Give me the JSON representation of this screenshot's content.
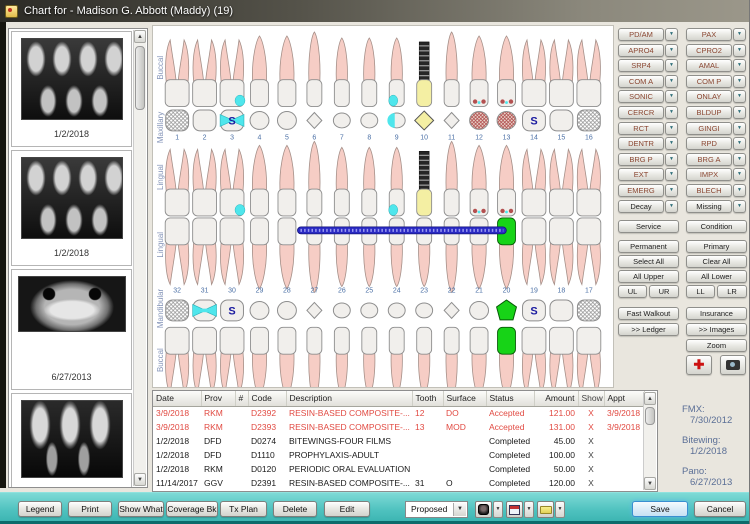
{
  "window": {
    "title": "Chart for - Madison G. Abbott (Maddy) (19)"
  },
  "sidebar": {
    "thumbnails": [
      {
        "date": "1/2/2018",
        "kind": "bitewing"
      },
      {
        "date": "1/2/2018",
        "kind": "bitewing"
      },
      {
        "date": "6/27/2013",
        "kind": "pano"
      },
      {
        "date": "",
        "kind": "periapical"
      }
    ]
  },
  "chart": {
    "region_labels": {
      "maxillary": "Maxillary",
      "mandibular": "Mandibular",
      "buccal": "Buccal",
      "lingual": "Lingual"
    },
    "upper_teeth": [
      {
        "n": 1,
        "type": "molar",
        "occ": "hatch"
      },
      {
        "n": 2,
        "type": "molar"
      },
      {
        "n": 3,
        "type": "molar",
        "occ": "bowtie+S",
        "crown": "cyan-distal"
      },
      {
        "n": 4,
        "type": "premolar"
      },
      {
        "n": 5,
        "type": "premolar"
      },
      {
        "n": 6,
        "type": "canine"
      },
      {
        "n": 7,
        "type": "incisor"
      },
      {
        "n": 8,
        "type": "incisor"
      },
      {
        "n": 9,
        "type": "incisor",
        "occ": "cyan",
        "crown": "cyan-corner"
      },
      {
        "n": 10,
        "type": "incisor",
        "occ": "yellow",
        "crown": "implant"
      },
      {
        "n": 11,
        "type": "canine"
      },
      {
        "n": 12,
        "type": "premolar",
        "occ": "red",
        "crown": "red-spots"
      },
      {
        "n": 13,
        "type": "premolar",
        "occ": "red",
        "crown": "red-spots"
      },
      {
        "n": 14,
        "type": "molar",
        "occ": "S"
      },
      {
        "n": 15,
        "type": "molar"
      },
      {
        "n": 16,
        "type": "molar",
        "occ": "hatch"
      }
    ],
    "lower_teeth": [
      {
        "n": 32,
        "type": "molar",
        "occ": "hatch"
      },
      {
        "n": 31,
        "type": "molar",
        "occ": "bowtie"
      },
      {
        "n": 30,
        "type": "molar",
        "occ": "S"
      },
      {
        "n": 29,
        "type": "premolar"
      },
      {
        "n": 28,
        "type": "premolar"
      },
      {
        "n": 27,
        "type": "canine"
      },
      {
        "n": 26,
        "type": "incisor"
      },
      {
        "n": 25,
        "type": "incisor"
      },
      {
        "n": 24,
        "type": "incisor"
      },
      {
        "n": 23,
        "type": "incisor"
      },
      {
        "n": 22,
        "type": "canine"
      },
      {
        "n": 21,
        "type": "premolar"
      },
      {
        "n": 20,
        "type": "premolar",
        "occ": "green",
        "crown": "green"
      },
      {
        "n": 19,
        "type": "molar",
        "occ": "S"
      },
      {
        "n": 18,
        "type": "molar"
      },
      {
        "n": 17,
        "type": "molar",
        "occ": "hatch"
      }
    ],
    "retainer_span": {
      "from": "27",
      "to": "21"
    }
  },
  "procedure_buttons": {
    "col1": [
      "PD/AM",
      "APRO4",
      "SRP4",
      "COM A",
      "SONIC",
      "CERCR",
      "RCT",
      "DENTR",
      "BRG P",
      "EXT",
      "EMERG"
    ],
    "col2": [
      "PAX",
      "CPRO2",
      "AMAL",
      "COM P",
      "ONLAY",
      "BLDUP",
      "GINGI",
      "RPD",
      "BRG A",
      "IMPX",
      "BLECH"
    ],
    "decay": "Decay",
    "missing": "Missing"
  },
  "selection_buttons": {
    "service": "Service",
    "condition": "Condition",
    "permanent": "Permanent",
    "primary": "Primary",
    "select_all": "Select All",
    "clear_all": "Clear All",
    "all_upper": "All Upper",
    "all_lower": "All Lower",
    "ul": "UL",
    "ur": "UR",
    "ll": "LL",
    "lr": "LR"
  },
  "nav_buttons": {
    "fast_walkout": "Fast Walkout",
    "insurance": "Insurance",
    "ledger": ">> Ledger",
    "images": ">> Images",
    "zoom": "Zoom"
  },
  "xray_summary": [
    {
      "label": "FMX:",
      "date": "7/30/2012"
    },
    {
      "label": "Bitewing:",
      "date": "1/2/2018"
    },
    {
      "label": "Pano:",
      "date": "6/27/2013"
    }
  ],
  "procedure_table": {
    "columns": [
      "Date",
      "Prov",
      "#",
      "Code",
      "Description",
      "Tooth",
      "Surface",
      "Status",
      "Amount",
      "Show",
      "Appt"
    ],
    "rows": [
      {
        "date": "3/9/2018",
        "prov": "RKM",
        "num": "",
        "code": "D2392",
        "description": "RESIN-BASED COMPOSITE-...",
        "tooth": "12",
        "surface": "DO",
        "status": "Accepted",
        "amount": "121.00",
        "show": "X",
        "appt": "3/9/2018",
        "highlight": "red"
      },
      {
        "date": "3/9/2018",
        "prov": "RKM",
        "num": "",
        "code": "D2393",
        "description": "RESIN-BASED COMPOSITE-...",
        "tooth": "13",
        "surface": "MOD",
        "status": "Accepted",
        "amount": "131.00",
        "show": "X",
        "appt": "3/9/2018",
        "highlight": "red"
      },
      {
        "date": "1/2/2018",
        "prov": "DFD",
        "num": "",
        "code": "D0274",
        "description": "BITEWINGS-FOUR FILMS",
        "tooth": "",
        "surface": "",
        "status": "Completed",
        "amount": "45.00",
        "show": "X",
        "appt": ""
      },
      {
        "date": "1/2/2018",
        "prov": "DFD",
        "num": "",
        "code": "D1110",
        "description": "PROPHYLAXIS-ADULT",
        "tooth": "",
        "surface": "",
        "status": "Completed",
        "amount": "100.00",
        "show": "X",
        "appt": ""
      },
      {
        "date": "1/2/2018",
        "prov": "RKM",
        "num": "",
        "code": "D0120",
        "description": "PERIODIC ORAL EVALUATION",
        "tooth": "",
        "surface": "",
        "status": "Completed",
        "amount": "50.00",
        "show": "X",
        "appt": ""
      },
      {
        "date": "11/14/2017",
        "prov": "GGV",
        "num": "",
        "code": "D2391",
        "description": "RESIN-BASED COMPOSITE-...",
        "tooth": "31",
        "surface": "O",
        "status": "Completed",
        "amount": "120.00",
        "show": "X",
        "appt": ""
      }
    ]
  },
  "footer": {
    "buttons": [
      "Legend",
      "Print",
      "Show What",
      "Coverage Bk",
      "Tx Plan",
      "Delete",
      "Edit"
    ],
    "view_filter": "Proposed",
    "save": "Save",
    "cancel": "Cancel"
  },
  "colors": {
    "teal_band": "#4fc2bf",
    "alert_red": "#cc1111",
    "row_red": "#e14a42",
    "tooth_pink": "#f6cdc5",
    "mark_cyan": "#4fe6ec",
    "mark_green": "#17d317",
    "mark_yellow": "#f4efa3",
    "sealant_blue": "#1b1ba0",
    "number_blue": "#4a6fa5"
  }
}
